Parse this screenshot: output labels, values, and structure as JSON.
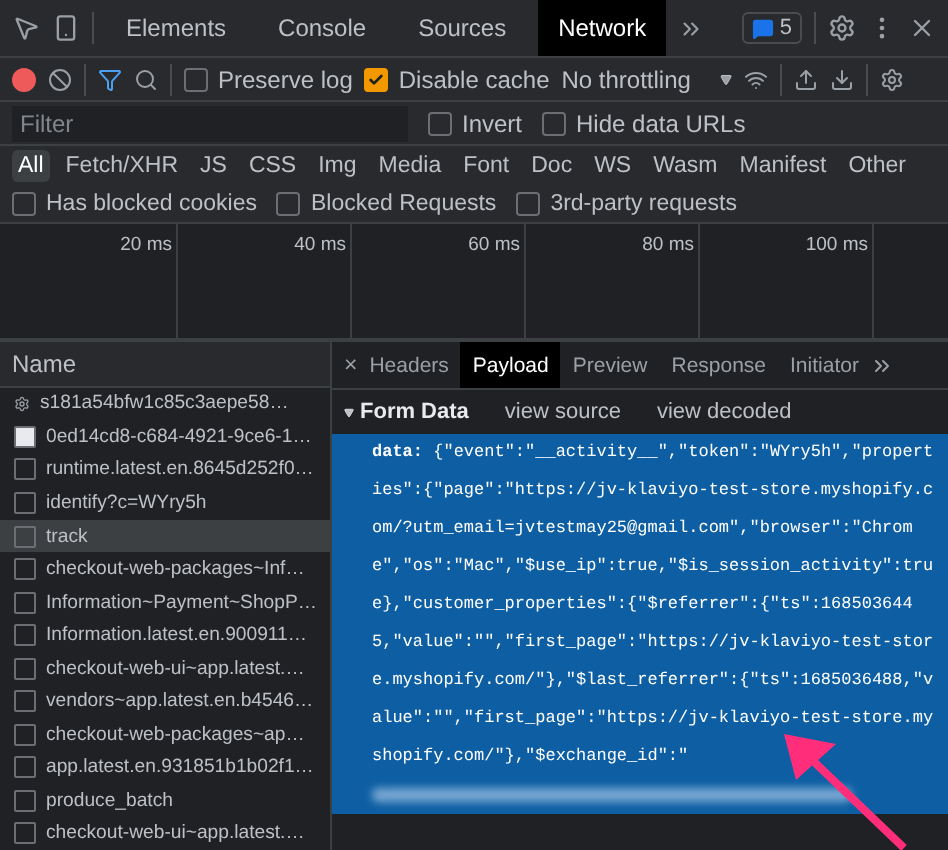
{
  "tabs": [
    {
      "label": "Elements",
      "selected": false
    },
    {
      "label": "Console",
      "selected": false
    },
    {
      "label": "Sources",
      "selected": false
    },
    {
      "label": "Network",
      "selected": true
    }
  ],
  "issues_badge": "5",
  "toolbar": {
    "recording": true,
    "preserve_log": {
      "label": "Preserve log",
      "checked": false
    },
    "disable_cache": {
      "label": "Disable cache",
      "checked": true
    },
    "throttling": "No throttling"
  },
  "filter": {
    "placeholder": "Filter",
    "options": [
      {
        "label": "Invert",
        "checked": false
      },
      {
        "label": "Hide data URLs",
        "checked": false
      }
    ]
  },
  "type_filters": [
    {
      "label": "All",
      "selected": true
    },
    {
      "label": "Fetch/XHR",
      "selected": false
    },
    {
      "label": "JS",
      "selected": false
    },
    {
      "label": "CSS",
      "selected": false
    },
    {
      "label": "Img",
      "selected": false
    },
    {
      "label": "Media",
      "selected": false
    },
    {
      "label": "Font",
      "selected": false
    },
    {
      "label": "Doc",
      "selected": false
    },
    {
      "label": "WS",
      "selected": false
    },
    {
      "label": "Wasm",
      "selected": false
    },
    {
      "label": "Manifest",
      "selected": false
    },
    {
      "label": "Other",
      "selected": false
    }
  ],
  "blocked_filters": [
    {
      "label": "Has blocked cookies",
      "checked": false
    },
    {
      "label": "Blocked Requests",
      "checked": false
    },
    {
      "label": "3rd-party requests",
      "checked": false
    }
  ],
  "timeline": {
    "ticks": [
      "20 ms",
      "40 ms",
      "60 ms",
      "80 ms",
      "100 ms"
    ]
  },
  "requests": {
    "column": "Name",
    "rows": [
      {
        "name": "s181a54bfw1c85c3aepe58…",
        "kind": "worker",
        "selected": false
      },
      {
        "name": "0ed14cd8-c684-4921-9ce6-1…",
        "kind": "document",
        "selected": false
      },
      {
        "name": "runtime.latest.en.8645d252f0…",
        "kind": "file",
        "selected": false
      },
      {
        "name": "identify?c=WYry5h",
        "kind": "file",
        "selected": false
      },
      {
        "name": "track",
        "kind": "file",
        "selected": true
      },
      {
        "name": "checkout-web-packages~Inf…",
        "kind": "file",
        "selected": false
      },
      {
        "name": "Information~Payment~ShopP…",
        "kind": "file",
        "selected": false
      },
      {
        "name": "Information.latest.en.900911…",
        "kind": "file",
        "selected": false
      },
      {
        "name": "checkout-web-ui~app.latest.…",
        "kind": "file",
        "selected": false
      },
      {
        "name": "vendors~app.latest.en.b4546…",
        "kind": "file",
        "selected": false
      },
      {
        "name": "checkout-web-packages~ap…",
        "kind": "file",
        "selected": false
      },
      {
        "name": "app.latest.en.931851b1b02f1…",
        "kind": "file",
        "selected": false
      },
      {
        "name": "produce_batch",
        "kind": "file",
        "selected": false
      },
      {
        "name": "checkout-web-ui~app.latest.…",
        "kind": "file",
        "selected": false
      }
    ]
  },
  "detail": {
    "close": "×",
    "tabs": [
      {
        "label": "Headers",
        "selected": false
      },
      {
        "label": "Payload",
        "selected": true
      },
      {
        "label": "Preview",
        "selected": false
      },
      {
        "label": "Response",
        "selected": false
      },
      {
        "label": "Initiator",
        "selected": false
      }
    ],
    "form_data": {
      "title": "Form Data",
      "expanded": true,
      "links": [
        "view source",
        "view decoded"
      ],
      "text": "**data:** {\"event\":\"__activity__\",\"token\":\"WYry5h\",\"properties\":{\"page\":\"https://jv-klaviyo-test-store.myshopify.com/?utm_email=jvtestmay25@gmail.com\",\"browser\":\"Chrome\",\"os\":\"Mac\",\"$use_ip\":true,\"$is_session_activity\":true},\"customer_properties\":{\"$referrer\":{\"ts\":1685036445,\"value\":\"\",\"first_page\":\"https://jv-klaviyo-test-store.myshopify.com/\"},\"$last_referrer\":{\"ts\":1685036488,\"value\":\"\",\"first_page\":\"https://jv-klaviyo-test-store.myshopify.com/\"},\"$exchange_id\":\"",
      "redacted": true
    }
  }
}
